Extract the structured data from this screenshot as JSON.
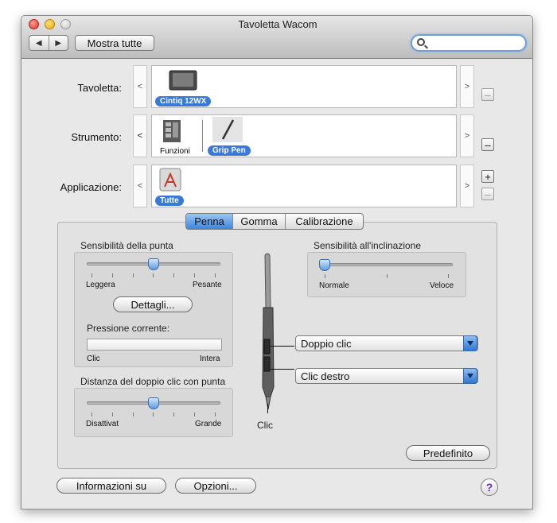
{
  "window": {
    "title": "Tavoletta Wacom"
  },
  "toolbar": {
    "back": "◀",
    "forward": "▶",
    "show_all": "Mostra tutte",
    "search_placeholder": ""
  },
  "rows": {
    "tablet": {
      "label": "Tavoletta:",
      "left_arrow": "<",
      "right_arrow": ">",
      "device": "Cintiq 12WX",
      "side_button": "–"
    },
    "tool": {
      "label": "Strumento:",
      "left_arrow": "<",
      "right_arrow": ">",
      "items": [
        "Funzioni",
        "Grip Pen"
      ],
      "side_button": "–"
    },
    "application": {
      "label": "Applicazione:",
      "left_arrow": "<",
      "right_arrow": ">",
      "item": "Tutte",
      "add_button": "+",
      "remove_button": "–"
    }
  },
  "tabs": [
    "Penna",
    "Gomma",
    "Calibrazione"
  ],
  "tip_sensitivity": {
    "title": "Sensibilità della punta",
    "min_label": "Leggera",
    "max_label": "Pesante",
    "level": 0.5,
    "details_button": "Dettagli...",
    "pressure_label": "Pressione corrente:",
    "pressure_min": "Clic",
    "pressure_max": "Intera"
  },
  "double_click_distance": {
    "title": "Distanza del doppio clic con punta",
    "min_label": "Disattivat",
    "max_label": "Grande",
    "level": 0.5
  },
  "tilt_sensitivity": {
    "title": "Sensibilità all'inclinazione",
    "min_label": "Normale",
    "max_label": "Veloce",
    "level": 0.0
  },
  "pen_buttons": {
    "upper": "Doppio clic",
    "lower": "Clic destro",
    "tip": "Clic"
  },
  "buttons": {
    "default": "Predefinito",
    "info": "Informazioni su",
    "options": "Opzioni...",
    "help": "?"
  },
  "colors": {
    "accent": "#3a79d6",
    "help": "#6b2fb8"
  }
}
